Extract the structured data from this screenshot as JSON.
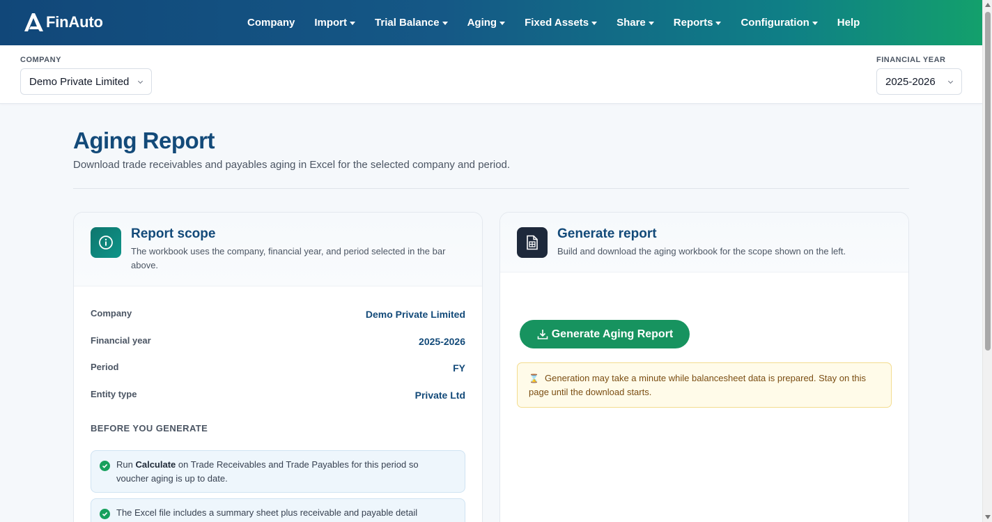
{
  "nav": {
    "brand": "FinAuto",
    "items": [
      {
        "label": "Company",
        "dropdown": false
      },
      {
        "label": "Import",
        "dropdown": true
      },
      {
        "label": "Trial Balance",
        "dropdown": true
      },
      {
        "label": "Aging",
        "dropdown": true
      },
      {
        "label": "Fixed Assets",
        "dropdown": true
      },
      {
        "label": "Share",
        "dropdown": true
      },
      {
        "label": "Reports",
        "dropdown": true
      },
      {
        "label": "Configuration",
        "dropdown": true
      },
      {
        "label": "Help",
        "dropdown": false
      }
    ]
  },
  "selector": {
    "company_label": "COMPANY",
    "company_value": "Demo Private Limited",
    "year_label": "FINANCIAL YEAR",
    "year_value": "2025-2026"
  },
  "page": {
    "title": "Aging Report",
    "subtitle": "Download trade receivables and payables aging in Excel for the selected company and period."
  },
  "scope_card": {
    "title": "Report scope",
    "description": "The workbook uses the company, financial year, and period selected in the bar above.",
    "rows": [
      {
        "label": "Company",
        "value": "Demo Private Limited"
      },
      {
        "label": "Financial year",
        "value": "2025-2026"
      },
      {
        "label": "Period",
        "value": "FY"
      },
      {
        "label": "Entity type",
        "value": "Private Ltd"
      }
    ],
    "section_label": "BEFORE YOU GENERATE",
    "checklist": [
      {
        "pre": "Run ",
        "bold": "Calculate",
        "post": " on Trade Receivables and Trade Payables for this period so voucher aging is up to date."
      },
      {
        "pre": "The Excel file includes a summary sheet plus receivable and payable detail",
        "bold": "",
        "post": ""
      }
    ]
  },
  "generate_card": {
    "title": "Generate report",
    "description": "Build and download the aging workbook for the scope shown on the left.",
    "button_label": "Generate Aging Report",
    "notice_icon": "⌛",
    "notice_text": "Generation may take a minute while balancesheet data is prepared. Stay on this page until the download starts."
  },
  "colors": {
    "brand_blue": "#134a79",
    "accent_green": "#17935f",
    "notice_bg": "#fffbe9"
  }
}
